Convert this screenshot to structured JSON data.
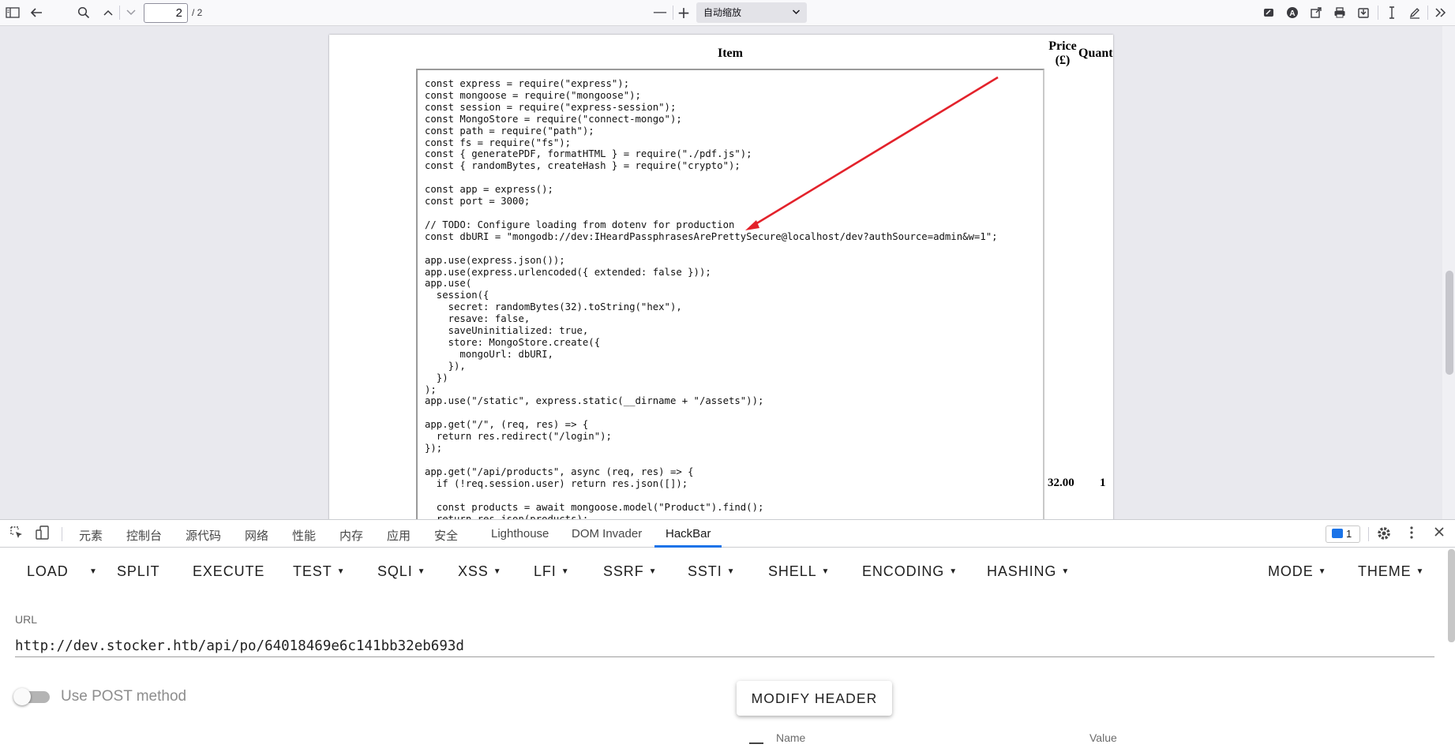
{
  "toolbar": {
    "sidebar_icon": "sidebar-toggle-icon",
    "back_icon": "arrow-left-icon",
    "find_icon": "search-icon",
    "page_current": "2",
    "page_total": "/ 2",
    "zoom_out": "—",
    "zoom_in": "+",
    "zoom_label": "自动缩放"
  },
  "pdf": {
    "columns": {
      "item": "Item",
      "price": "Price\n(£)",
      "quantity": "Quant"
    },
    "code": "const express = require(\"express\");\nconst mongoose = require(\"mongoose\");\nconst session = require(\"express-session\");\nconst MongoStore = require(\"connect-mongo\");\nconst path = require(\"path\");\nconst fs = require(\"fs\");\nconst { generatePDF, formatHTML } = require(\"./pdf.js\");\nconst { randomBytes, createHash } = require(\"crypto\");\n\nconst app = express();\nconst port = 3000;\n\n// TODO: Configure loading from dotenv for production\nconst dbURI = \"mongodb://dev:IHeardPassphrasesArePrettySecure@localhost/dev?authSource=admin&w=1\";\n\napp.use(express.json());\napp.use(express.urlencoded({ extended: false }));\napp.use(\n  session({\n    secret: randomBytes(32).toString(\"hex\"),\n    resave: false,\n    saveUninitialized: true,\n    store: MongoStore.create({\n      mongoUrl: dbURI,\n    }),\n  })\n);\napp.use(\"/static\", express.static(__dirname + \"/assets\"));\n\napp.get(\"/\", (req, res) => {\n  return res.redirect(\"/login\");\n});\n\napp.get(\"/api/products\", async (req, res) => {\n  if (!req.session.user) return res.json([]);\n\n  const products = await mongoose.model(\"Product\").find();\n  return res.json(products);",
    "price": "32.00",
    "quantity": "1"
  },
  "devtools": {
    "tabs": [
      "元素",
      "控制台",
      "源代码",
      "网络",
      "性能",
      "内存",
      "应用",
      "安全",
      "Lighthouse",
      "DOM Invader",
      "HackBar"
    ],
    "active_tab": "HackBar",
    "issues_count": "1"
  },
  "hackbar": {
    "buttons": [
      "LOAD",
      "SPLIT",
      "EXECUTE",
      "TEST",
      "SQLI",
      "XSS",
      "LFI",
      "SSRF",
      "SSTI",
      "SHELL",
      "ENCODING",
      "HASHING",
      "MODE",
      "THEME"
    ],
    "url_label": "URL",
    "url_value": "http://dev.stocker.htb/api/po/64018469e6c141bb32eb693d",
    "post_label": "Use POST method",
    "modify_header": "MODIFY HEADER",
    "header_name": "Name",
    "header_value": "Value"
  },
  "colors": {
    "accent": "#1a73e8",
    "arrow": "#e3222b"
  }
}
